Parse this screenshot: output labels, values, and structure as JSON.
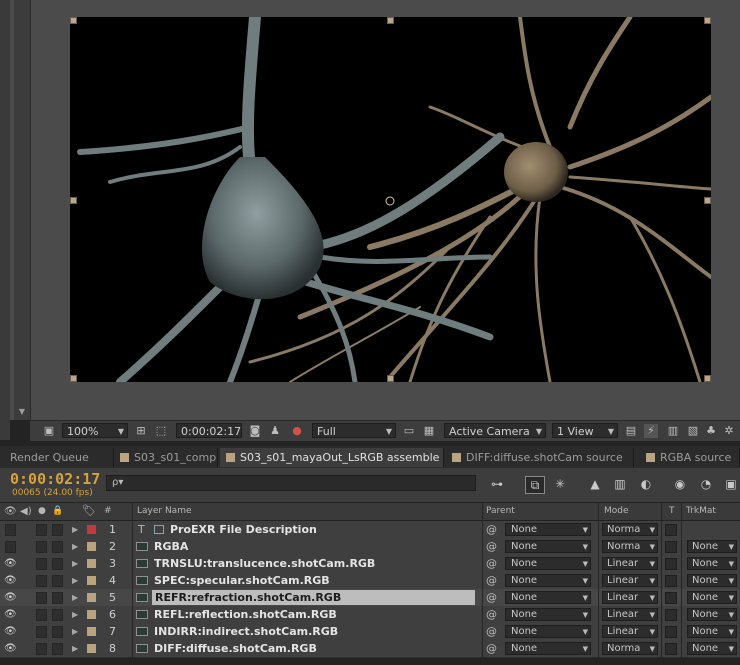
{
  "viewer": {
    "zoom": "100%",
    "timecode": "0:00:02:17",
    "resolution": "Full",
    "camera": "Active Camera",
    "views": "1 View"
  },
  "tabs": [
    {
      "label": "Render Queue",
      "active": false,
      "swatch": false,
      "close": false
    },
    {
      "label": "S03_s01_comp",
      "active": false,
      "swatch": true,
      "close": false
    },
    {
      "label": "S03_s01_mayaOut_LsRGB assemble",
      "active": true,
      "swatch": true,
      "close": true
    },
    {
      "label": "DIFF:diffuse.shotCam source",
      "active": false,
      "swatch": true,
      "close": false
    },
    {
      "label": "RGBA source",
      "active": false,
      "swatch": true,
      "close": false
    }
  ],
  "timeline": {
    "timecode": "0:00:02:17",
    "frames": "00065 (24.00 fps)",
    "search_placeholder": "ρ▾"
  },
  "columns": {
    "num": "#",
    "layer_name": "Layer Name",
    "parent": "Parent",
    "mode": "Mode",
    "t": "T",
    "trkmat": "TrkMat"
  },
  "layers": [
    {
      "num": "1",
      "name": "ProEXR File Description",
      "color": "#c23a3a",
      "type": "text",
      "parent": "None",
      "mode": "Norma",
      "trkmat": "",
      "visible": false,
      "selected": false
    },
    {
      "num": "2",
      "name": "RGBA",
      "color": "#b9a47f",
      "type": "comp",
      "parent": "None",
      "mode": "Norma",
      "trkmat": "None",
      "visible": false,
      "selected": false
    },
    {
      "num": "3",
      "name": "TRNSLU:translucence.shotCam.RGB",
      "color": "#b9a47f",
      "type": "comp",
      "parent": "None",
      "mode": "Linear",
      "trkmat": "None",
      "visible": true,
      "selected": false
    },
    {
      "num": "4",
      "name": "SPEC:specular.shotCam.RGB",
      "color": "#b9a47f",
      "type": "comp",
      "parent": "None",
      "mode": "Linear",
      "trkmat": "None",
      "visible": true,
      "selected": false
    },
    {
      "num": "5",
      "name": "REFR:refraction.shotCam.RGB",
      "color": "#b9a47f",
      "type": "comp",
      "parent": "None",
      "mode": "Linear",
      "trkmat": "None",
      "visible": true,
      "selected": true
    },
    {
      "num": "6",
      "name": "REFL:reflection.shotCam.RGB",
      "color": "#b9a47f",
      "type": "comp",
      "parent": "None",
      "mode": "Linear",
      "trkmat": "None",
      "visible": true,
      "selected": false
    },
    {
      "num": "7",
      "name": "INDIRR:indirect.shotCam.RGB",
      "color": "#b9a47f",
      "type": "comp",
      "parent": "None",
      "mode": "Linear",
      "trkmat": "None",
      "visible": true,
      "selected": false
    },
    {
      "num": "8",
      "name": "DIFF:diffuse.shotCam.RGB",
      "color": "#b9a47f",
      "type": "comp",
      "parent": "None",
      "mode": "Norma",
      "trkmat": "None",
      "visible": true,
      "selected": false
    }
  ]
}
